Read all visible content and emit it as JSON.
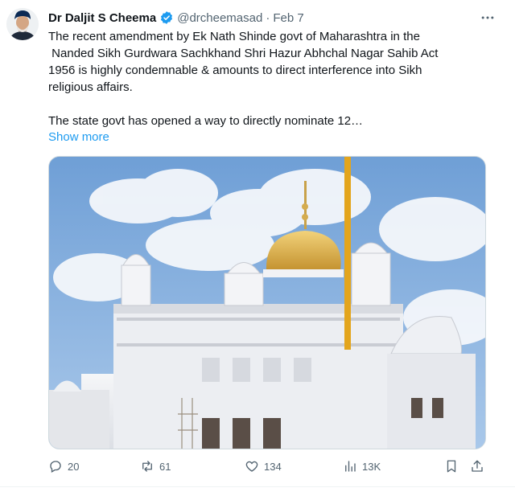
{
  "author": {
    "name": "Dr Daljit S Cheema",
    "handle": "@drcheemasad",
    "separator": "·",
    "date": "Feb 7",
    "verified": true
  },
  "tweet": {
    "text": "The recent amendment by Ek Nath Shinde govt of Maharashtra in the\n Nanded Sikh Gurdwara Sachkhand Shri Hazur Abhchal Nagar Sahib Act\n1956 is highly condemnable & amounts to direct interference into Sikh\nreligious affairs.\n\nThe state govt has opened a way to directly nominate 12…",
    "show_more": "Show more"
  },
  "actions": {
    "replies": "20",
    "reposts": "61",
    "likes": "134",
    "views": "13K"
  },
  "icons": {
    "more": "more-horizontal-icon",
    "verified": "verified-badge-icon",
    "reply": "reply-icon",
    "repost": "repost-icon",
    "like": "heart-icon",
    "views": "views-chart-icon",
    "bookmark": "bookmark-icon",
    "share": "share-icon"
  },
  "colors": {
    "accent": "#1d9bf0",
    "text": "#0f1419",
    "muted": "#536471"
  }
}
